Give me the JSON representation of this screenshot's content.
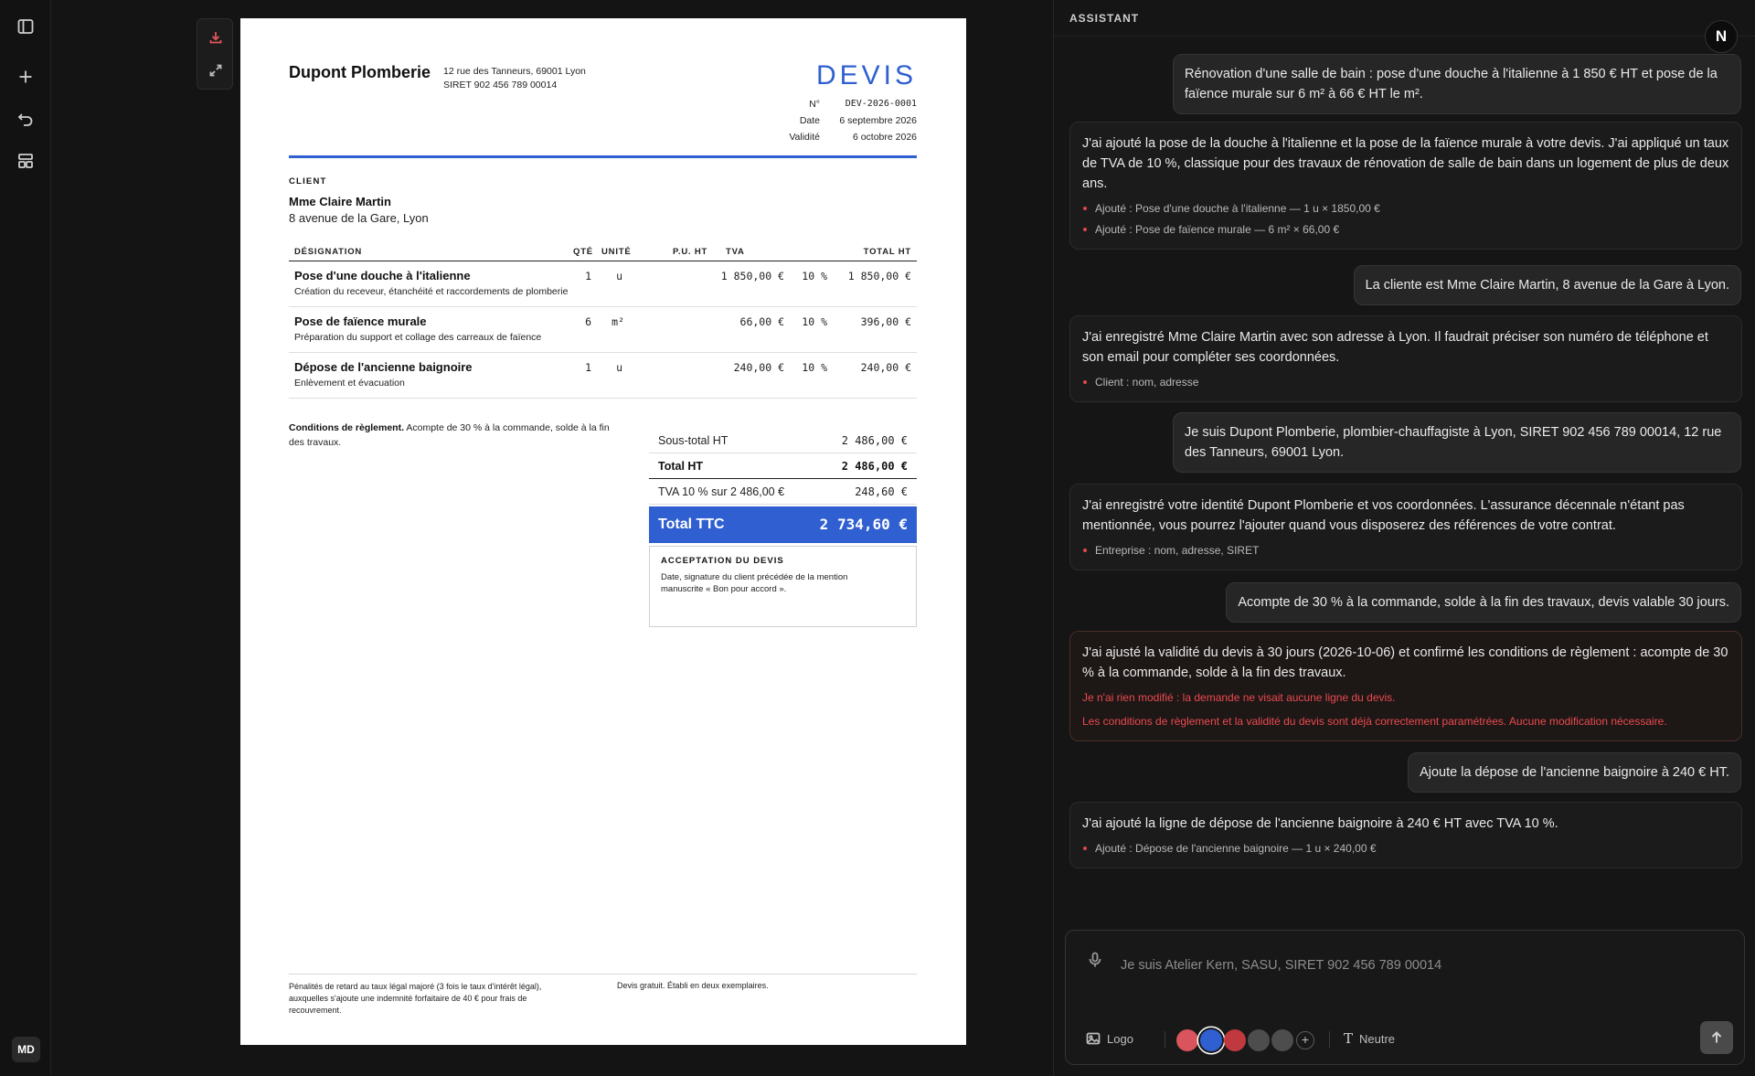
{
  "rail": {
    "icons": [
      "sidebar-toggle-icon",
      "plus-icon",
      "undo-icon",
      "layout-icon"
    ],
    "avatar": "MD"
  },
  "document": {
    "company": {
      "name": "Dupont Plomberie",
      "address": "12 rue des Tanneurs, 69001 Lyon",
      "siret": "SIRET 902 456 789 00014"
    },
    "title": "DEVIS",
    "meta": [
      {
        "label": "N°",
        "value": "DEV-2026-0001"
      },
      {
        "label": "Date",
        "value": "6 septembre 2026"
      },
      {
        "label": "Validité",
        "value": "6 octobre 2026"
      }
    ],
    "client": {
      "label": "CLIENT",
      "name": "Mme Claire Martin",
      "address": "8 avenue de la Gare, Lyon"
    },
    "table": {
      "headers": {
        "designation": "DÉSIGNATION",
        "qty": "QTÉ",
        "unit": "UNITÉ",
        "unit_price": "P.U. HT",
        "vat": "TVA",
        "total": "TOTAL HT"
      },
      "rows": [
        {
          "designation": "Pose d'une douche à l'italienne",
          "description": "Création du receveur, étanchéité et raccordements de plomberie",
          "qty": "1",
          "unit": "u",
          "unit_price": "1 850,00 €",
          "vat": "10 %",
          "total": "1 850,00 €"
        },
        {
          "designation": "Pose de faïence murale",
          "description": "Préparation du support et collage des carreaux de faïence",
          "qty": "6",
          "unit": "m²",
          "unit_price": "66,00 €",
          "vat": "10 %",
          "total": "396,00 €"
        },
        {
          "designation": "Dépose de l'ancienne baignoire",
          "description": "Enlèvement et évacuation",
          "qty": "1",
          "unit": "u",
          "unit_price": "240,00 €",
          "vat": "10 %",
          "total": "240,00 €"
        }
      ]
    },
    "conditions": {
      "label": "Conditions de règlement.",
      "text": " Acompte de 30 % à la commande, solde à la fin des travaux."
    },
    "totals": {
      "subtotal_label": "Sous-total HT",
      "subtotal_value": "2 486,00 €",
      "total_ht_label": "Total HT",
      "total_ht_value": "2 486,00 €",
      "vat_label": "TVA 10 % sur 2 486,00 €",
      "vat_value": "248,60 €",
      "ttc_label": "Total TTC",
      "ttc_value": "2 734,60 €"
    },
    "acceptance": {
      "title": "ACCEPTATION DU DEVIS",
      "text": "Date, signature du client précédée de la mention manuscrite « Bon pour accord »."
    },
    "footer": {
      "left": "Pénalités de retard au taux légal majoré (3 fois le taux d'intérêt légal), auxquelles s'ajoute une indemnité forfaitaire de 40 € pour frais de recouvrement.",
      "right": "Devis gratuit. Établi en deux exemplaires."
    }
  },
  "assistant": {
    "title": "ASSISTANT",
    "badge": "N",
    "messages": [
      {
        "role": "user",
        "text": "Rénovation d'une salle de bain : pose d'une douche à l'italienne à 1 850 € HT et pose de la faïence murale sur 6 m² à 66 € HT le m²."
      },
      {
        "role": "assistant",
        "text": "J'ai ajouté la pose de la douche à l'italienne et la pose de la faïence murale à votre devis. J'ai appliqué un taux de TVA de 10 %, classique pour des travaux de rénovation de salle de bain dans un logement de plus de deux ans.",
        "bullets": [
          "Ajouté : Pose d'une douche à l'italienne — 1 u × 1850,00 €",
          "Ajouté : Pose de faïence murale — 6 m² × 66,00 €"
        ]
      },
      {
        "role": "user",
        "text": "La cliente est Mme Claire Martin, 8 avenue de la Gare à Lyon."
      },
      {
        "role": "assistant",
        "text": "J'ai enregistré Mme Claire Martin avec son adresse à Lyon. Il faudrait préciser son numéro de téléphone et son email pour compléter ses coordonnées.",
        "bullets": [
          "Client : nom, adresse"
        ]
      },
      {
        "role": "user",
        "text": "Je suis Dupont Plomberie, plombier-chauffagiste à Lyon, SIRET 902 456 789 00014, 12 rue des Tanneurs, 69001 Lyon."
      },
      {
        "role": "assistant",
        "text": "J'ai enregistré votre identité Dupont Plomberie et vos coordonnées. L'assurance décennale n'étant pas mentionnée, vous pourrez l'ajouter quand vous disposerez des références de votre contrat.",
        "bullets": [
          "Entreprise : nom, adresse, SIRET"
        ]
      },
      {
        "role": "user",
        "text": "Acompte de 30 % à la commande, solde à la fin des travaux, devis valable 30 jours."
      },
      {
        "role": "assistant",
        "text": "J'ai ajusté la validité du devis à 30 jours (2026-10-06) et confirmé les conditions de règlement : acompte de 30 % à la commande, solde à la fin des travaux.",
        "warnings": [
          "Je n'ai rien modifié : la demande ne visait aucune ligne du devis.",
          "Les conditions de règlement et la validité du devis sont déjà correctement paramétrées. Aucune modification nécessaire."
        ]
      },
      {
        "role": "user",
        "text": "Ajoute la dépose de l'ancienne baignoire à 240 € HT."
      },
      {
        "role": "assistant",
        "text": "J'ai ajouté la ligne de dépose de l'ancienne baignoire à 240 € HT avec TVA 10 %.",
        "bullets": [
          "Ajouté : Dépose de l'ancienne baignoire — 1 u × 240,00 €"
        ]
      }
    ],
    "composer": {
      "placeholder": "Je suis Atelier Kern, SASU, SIRET 902 456 789 00014",
      "logo_label": "Logo",
      "swatches": [
        "#d9545c",
        "#2f5fd0",
        "#c0393f",
        "#4d4d4d",
        "#4d4d4d"
      ],
      "selected_swatch": 1,
      "font_label": "Neutre"
    }
  },
  "colors": {
    "accent": "#2f5fd0",
    "warning": "#ec4a4f",
    "bullet": "#e0474c"
  }
}
